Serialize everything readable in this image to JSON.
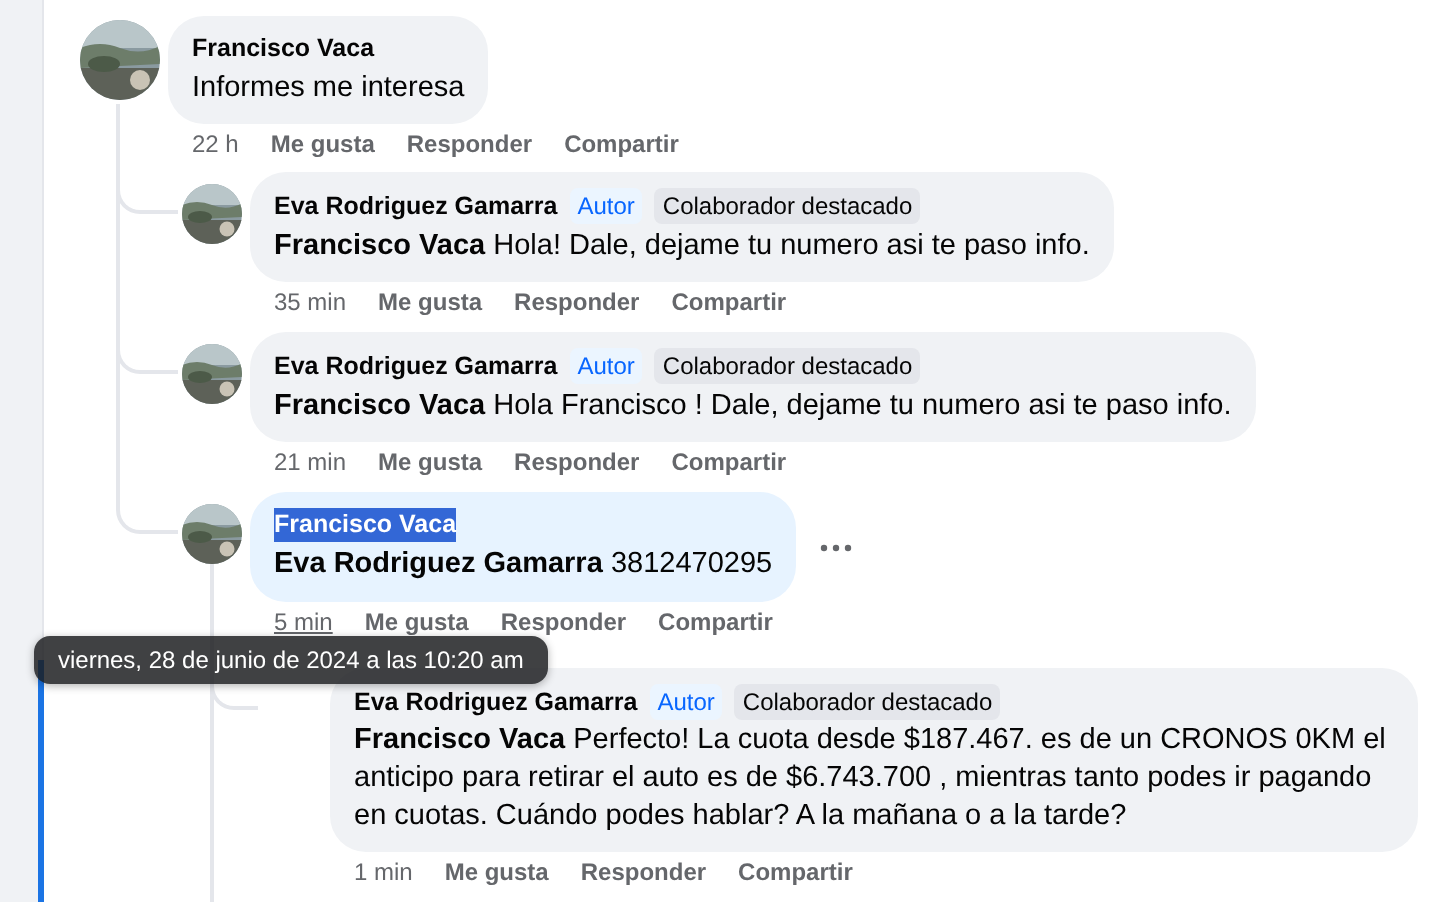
{
  "comments": [
    {
      "author": "Francisco Vaca",
      "text": "Informes me interesa",
      "time": "22 h",
      "actions": [
        "Me gusta",
        "Responder",
        "Compartir"
      ],
      "replies": [
        {
          "author": "Eva Rodriguez Gamarra",
          "badges": [
            {
              "label": "Autor",
              "kind": "author"
            },
            {
              "label": "Colaborador destacado",
              "kind": "contributor"
            }
          ],
          "mention": "Francisco Vaca",
          "text": "Hola! Dale, dejame tu numero asi te paso info.",
          "time": "35 min",
          "actions": [
            "Me gusta",
            "Responder",
            "Compartir"
          ]
        },
        {
          "author": "Eva Rodriguez Gamarra",
          "badges": [
            {
              "label": "Autor",
              "kind": "author"
            },
            {
              "label": "Colaborador destacado",
              "kind": "contributor"
            }
          ],
          "mention": "Francisco Vaca",
          "text": "Hola Francisco ! Dale, dejame tu numero asi te paso info.",
          "time": "21 min",
          "actions": [
            "Me gusta",
            "Responder",
            "Compartir"
          ]
        },
        {
          "author": "Francisco Vaca",
          "author_selected": true,
          "mention": "Eva Rodriguez Gamarra",
          "text": "3812470295",
          "time": "5 min",
          "time_hovered": true,
          "highlighted": true,
          "more_menu": true,
          "actions": [
            "Me gusta",
            "Responder",
            "Compartir"
          ],
          "replies": [
            {
              "author": "Eva Rodriguez Gamarra",
              "avatar_hidden": true,
              "badges": [
                {
                  "label": "Autor",
                  "kind": "author"
                },
                {
                  "label": "Colaborador destacado",
                  "kind": "contributor"
                }
              ],
              "mention": "Francisco Vaca",
              "text": "Perfecto! La cuota desde $187.467. es de un CRONOS 0KM el anticipo para retirar el auto es de $6.743.700 , mientras tanto podes ir pagando en cuotas. Cuándo podes hablar? A la mañana o a la tarde?",
              "time": "1 min",
              "actions": [
                "Me gusta",
                "Responder",
                "Compartir"
              ]
            }
          ]
        }
      ]
    }
  ],
  "tooltip": "viernes, 28 de junio de 2024 a las 10:20 am"
}
